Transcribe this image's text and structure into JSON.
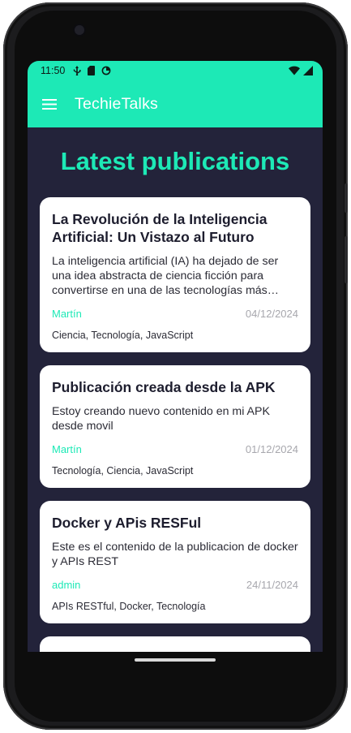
{
  "status_bar": {
    "time": "11:50",
    "left_icons": [
      "usb-icon",
      "sim-card-icon",
      "data-saver-icon"
    ],
    "right_icons": [
      "wifi-icon",
      "cell-signal-icon"
    ]
  },
  "app_bar": {
    "title": "TechieTalks",
    "menu_icon": "hamburger-menu-icon"
  },
  "page": {
    "title": "Latest publications"
  },
  "posts": [
    {
      "title": "La Revolución de la Inteligencia Artificial: Un Vistazo al Futuro",
      "excerpt": "La inteligencia artificial (IA) ha dejado de ser una idea abstracta de ciencia ficción para convertirse en una de las tecnologías más relevantes",
      "author": "Martín",
      "date": "04/12/2024",
      "tags": "Ciencia, Tecnología, JavaScript"
    },
    {
      "title": "Publicación creada desde la APK",
      "excerpt": "Estoy creando nuevo contenido en mi APK desde movil",
      "author": "Martín",
      "date": "01/12/2024",
      "tags": "Tecnología, Ciencia, JavaScript"
    },
    {
      "title": "Docker y APis RESFul",
      "excerpt": "Este es el contenido de la publicacion de docker y APIs REST",
      "author": "admin",
      "date": "24/11/2024",
      "tags": "APIs RESTful, Docker, Tecnología"
    }
  ],
  "colors": {
    "accent": "#1de9b6",
    "background": "#23233a",
    "card": "#ffffff",
    "date": "#a7a7ad"
  }
}
